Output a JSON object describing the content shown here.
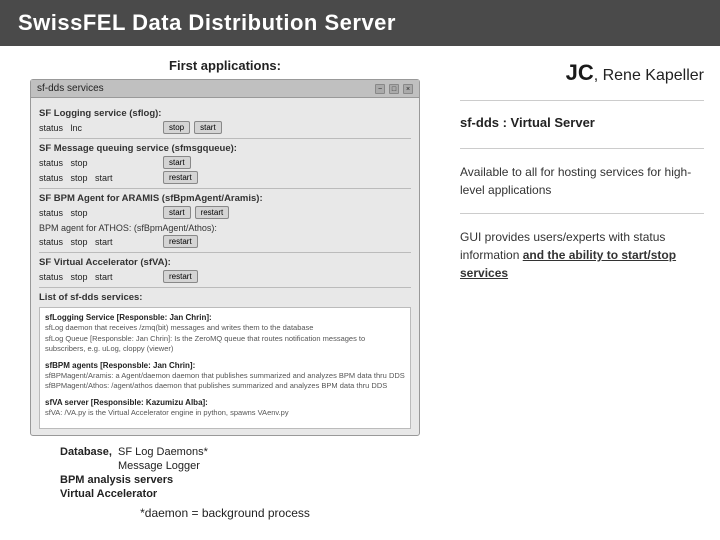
{
  "header": {
    "title": "SwissFEL Data Distribution Server"
  },
  "jc": {
    "label": "JC",
    "authors": ", Rene Kapeller"
  },
  "gui_window": {
    "title": "sf-dds services",
    "sections": [
      {
        "title": "SF Logging service (sflog):",
        "services": [
          {
            "name": "status  lnc",
            "buttons": [
              "stop",
              "start"
            ]
          }
        ]
      },
      {
        "title": "SF Message queuing service (sfmsgqueue):",
        "services": [
          {
            "name": "status  stop",
            "buttons": [
              "start"
            ]
          },
          {
            "name": "status  stop  start",
            "buttons": [
              "restart"
            ]
          }
        ]
      },
      {
        "title": "SF BPM Agent for ARAMIS (sfBpmAgent/Aramis):",
        "services": [
          {
            "name": "status  stop",
            "buttons": [
              "start",
              "restart"
            ]
          },
          {
            "name": "BPM agent for ATHOS: (sfBpmAgent/Athos):",
            "buttons": []
          },
          {
            "name": "status  stop  start",
            "buttons": [
              "restart"
            ]
          }
        ]
      },
      {
        "title": "SF Virtual Accelerator (sfVA):",
        "services": [
          {
            "name": "status  stop  start",
            "buttons": [
              "restart"
            ]
          }
        ]
      }
    ],
    "list_title": "List of sf-dds services:",
    "list_entries": [
      {
        "title": "sfLogging Service [Responsble: Jan Chrin]:",
        "desc": "sfLog daemon that receives /zmq(bit) messages and writes them to the database sfLog Queue [Responsble: Jan Chrin]: Is the ZeroMQ (zeromq) that roules notification messages to subscribers, e.g. uLog, cloppy (viewer)"
      },
      {
        "title": "sfBPM agents [Responsble: Jan Chrin]:",
        "desc": "sfBPMagent/Aramis: a Agent/daemon daemon that publishes summarized and analyzes BPM data thru DDS sfBPMagent/Athos: /agent/athos daemon that publishes summarized and analyzes BPM data thru DDS"
      },
      {
        "title": "sfVA server [Responsible: Kazumizu Alba]:",
        "desc": "sfVA: /VA.py is the Virtual Accelerator engine in python, spawns VAenv.py"
      }
    ]
  },
  "left_annotations": {
    "first_applications_label": "First applications:",
    "items": [
      {
        "label": "Database",
        "text": "SF Log Daemons*"
      },
      {
        "label": "",
        "text": "Message Logger"
      },
      {
        "label": "BPM analysis servers",
        "text": ""
      },
      {
        "label": "Virtual Accelerator",
        "text": ""
      }
    ]
  },
  "bottom_label": "*daemon = background process",
  "right_blocks": [
    {
      "id": "sf-dds-virtual",
      "title": "sf-dds : Virtual Server",
      "body": ""
    },
    {
      "id": "available-hosting",
      "title": "Available to all for hosting services for high-level applications",
      "body": ""
    },
    {
      "id": "gui-info",
      "title": "",
      "body": "GUI provides users/experts with status information and the ability to start/stop services"
    }
  ]
}
